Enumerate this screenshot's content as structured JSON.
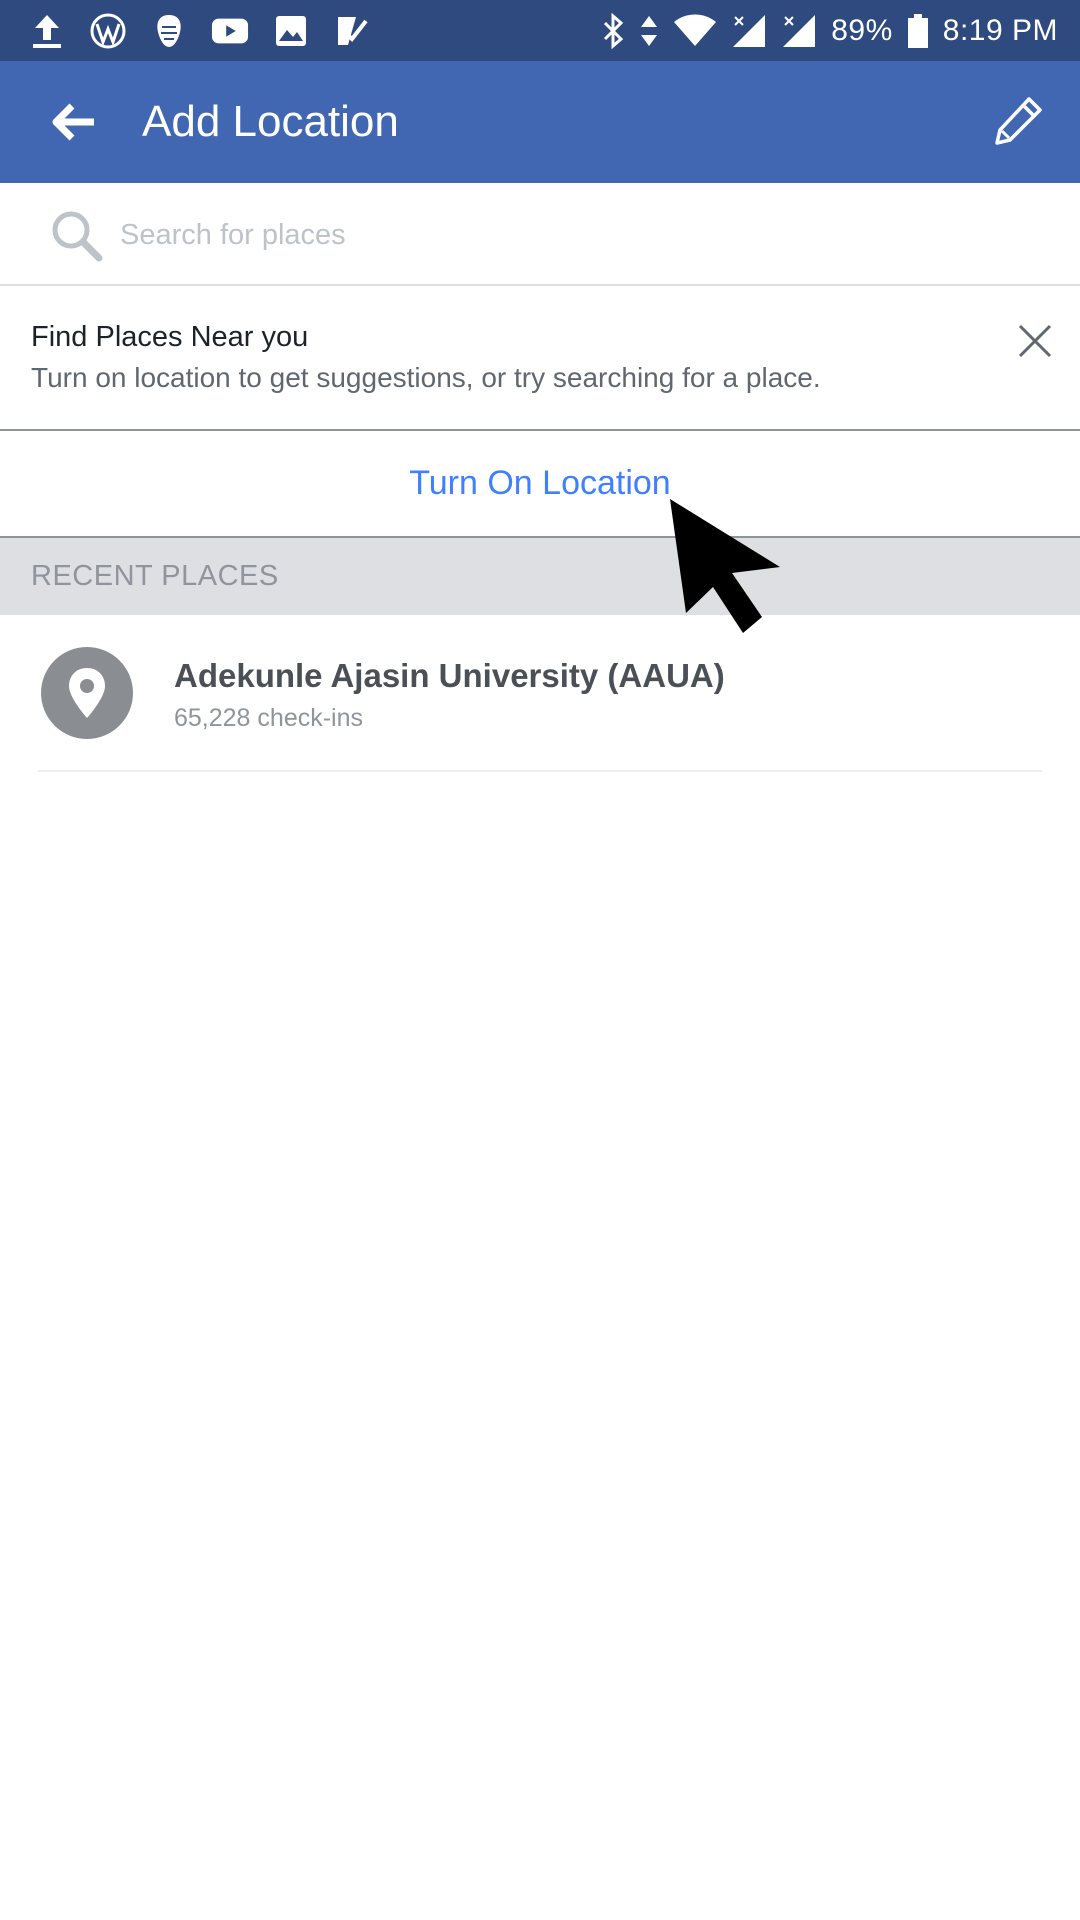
{
  "status_bar": {
    "left_icons": [
      "upload-icon",
      "wordpress-icon",
      "brand-mask-icon",
      "youtube-icon",
      "image-icon",
      "checklist-icon"
    ],
    "right_icons": [
      "bluetooth-icon",
      "data-arrows-icon",
      "wifi-icon",
      "signal-icon",
      "signal-icon"
    ],
    "battery": "89%",
    "time": "8:19 PM"
  },
  "app_bar": {
    "title": "Add Location",
    "back_icon": "back-arrow-icon",
    "edit_icon": "pencil-icon",
    "color": "#4267b2"
  },
  "search": {
    "placeholder": "Search for places",
    "value": ""
  },
  "info_card": {
    "title": "Find Places Near you",
    "text": "Turn on location to get suggestions, or try searching for a place."
  },
  "actions": {
    "turn_on_location": "Turn On Location",
    "accent_color": "#4080ff"
  },
  "recent_places": {
    "header": "RECENT PLACES",
    "items": [
      {
        "name": "Adekunle Ajasin University (AAUA)",
        "meta": "65,228 check-ins",
        "icon": "location-pin-icon"
      }
    ]
  }
}
